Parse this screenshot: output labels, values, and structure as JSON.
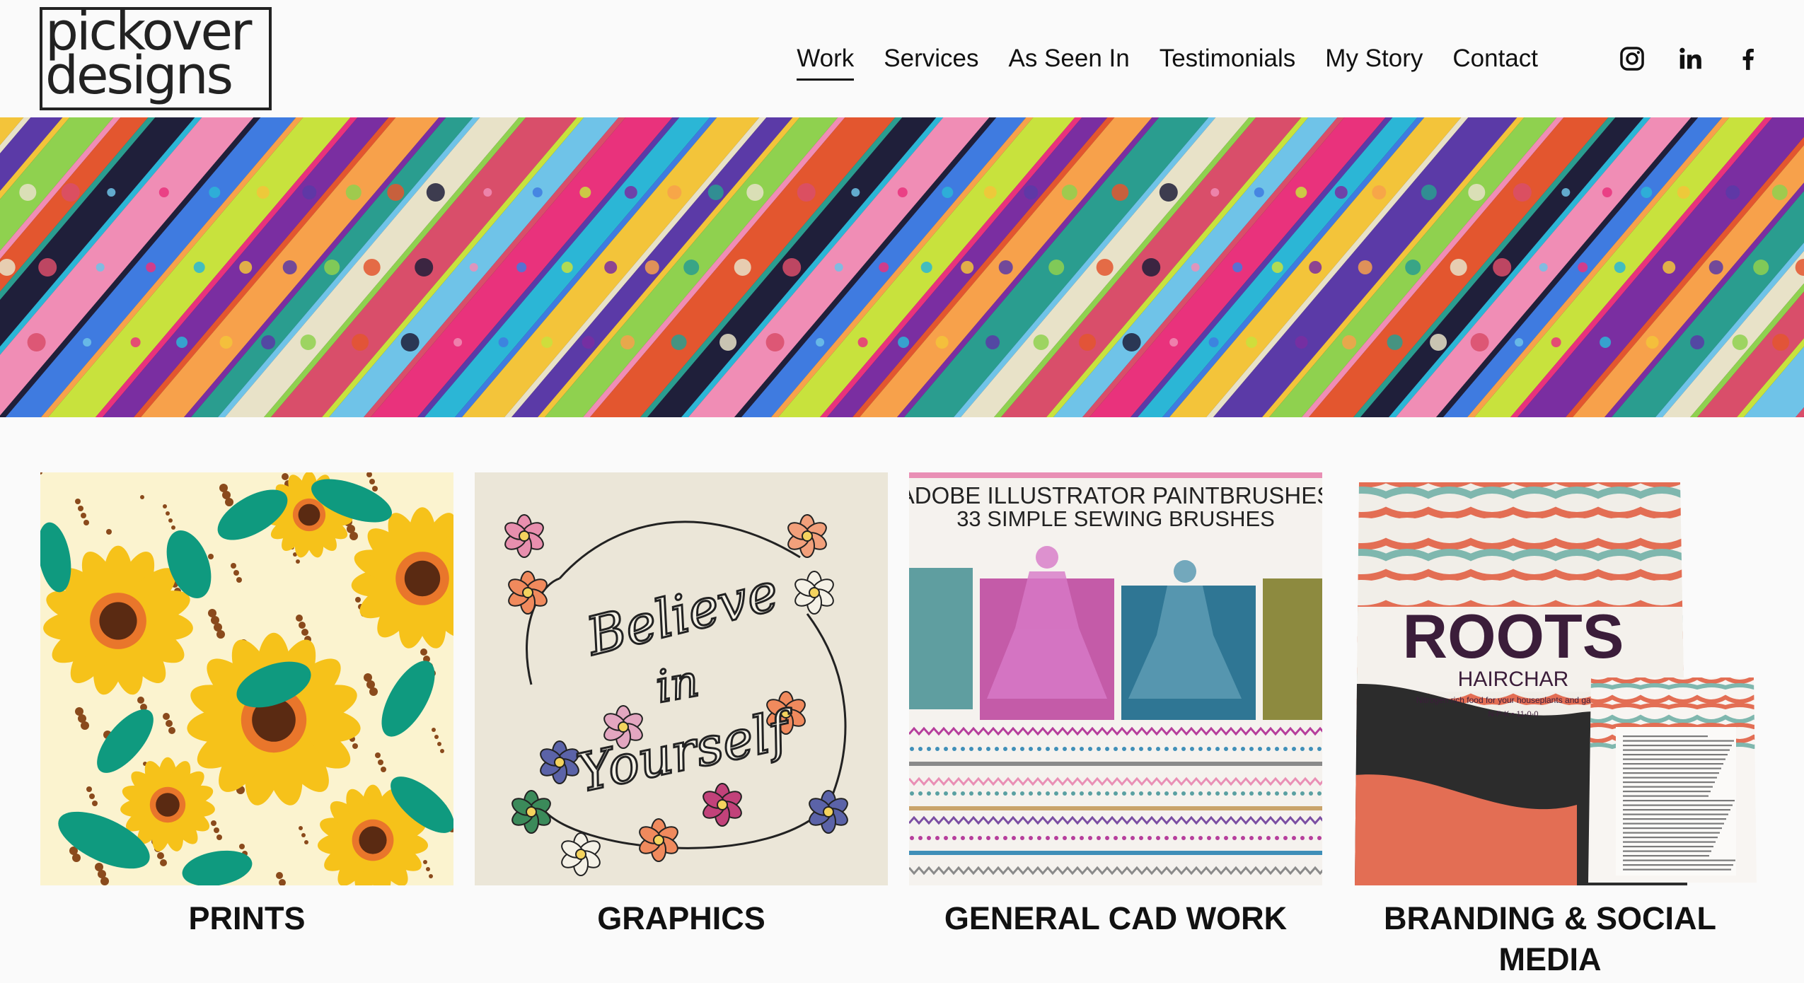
{
  "logo": {
    "line1": "pickover",
    "line2": "designs"
  },
  "nav": {
    "items": [
      {
        "label": "Work",
        "active": true
      },
      {
        "label": "Services"
      },
      {
        "label": "As Seen In"
      },
      {
        "label": "Testimonials"
      },
      {
        "label": "My Story"
      },
      {
        "label": "Contact"
      }
    ]
  },
  "socials": [
    "instagram-icon",
    "linkedin-icon",
    "facebook-icon"
  ],
  "gallery": [
    {
      "caption": "PRINTS"
    },
    {
      "caption": "GRAPHICS",
      "artwork_text": {
        "line1": "Believe",
        "line2": "in",
        "line3": "Yourself"
      }
    },
    {
      "caption": "GENERAL CAD WORK",
      "artwork_text": {
        "line1": "ADOBE ILLUSTRATOR PAINTBRUSHES",
        "line2": "33 SIMPLE SEWING BRUSHES"
      }
    },
    {
      "caption": "BRANDING & SOCIAL MEDIA",
      "artwork_text": {
        "brand": "ROOTS",
        "product": "HAIRCHAR",
        "tagline": "Nitrogen rich food for your houseplants and garden.",
        "npk": "N-P-K • 11-0-0"
      }
    }
  ],
  "colors": {
    "accent": "#111111",
    "banner_stripes": [
      "#e9327c",
      "#2bb6d6",
      "#f3c43a",
      "#5b3aa7",
      "#8fd14f",
      "#e3562f",
      "#1f1f3a",
      "#f08db5",
      "#3f7be0",
      "#c8e23d",
      "#7a2ea1",
      "#f7a14b",
      "#2a9d8f",
      "#e8e2c8",
      "#d94e6a",
      "#6fc3e8"
    ]
  }
}
